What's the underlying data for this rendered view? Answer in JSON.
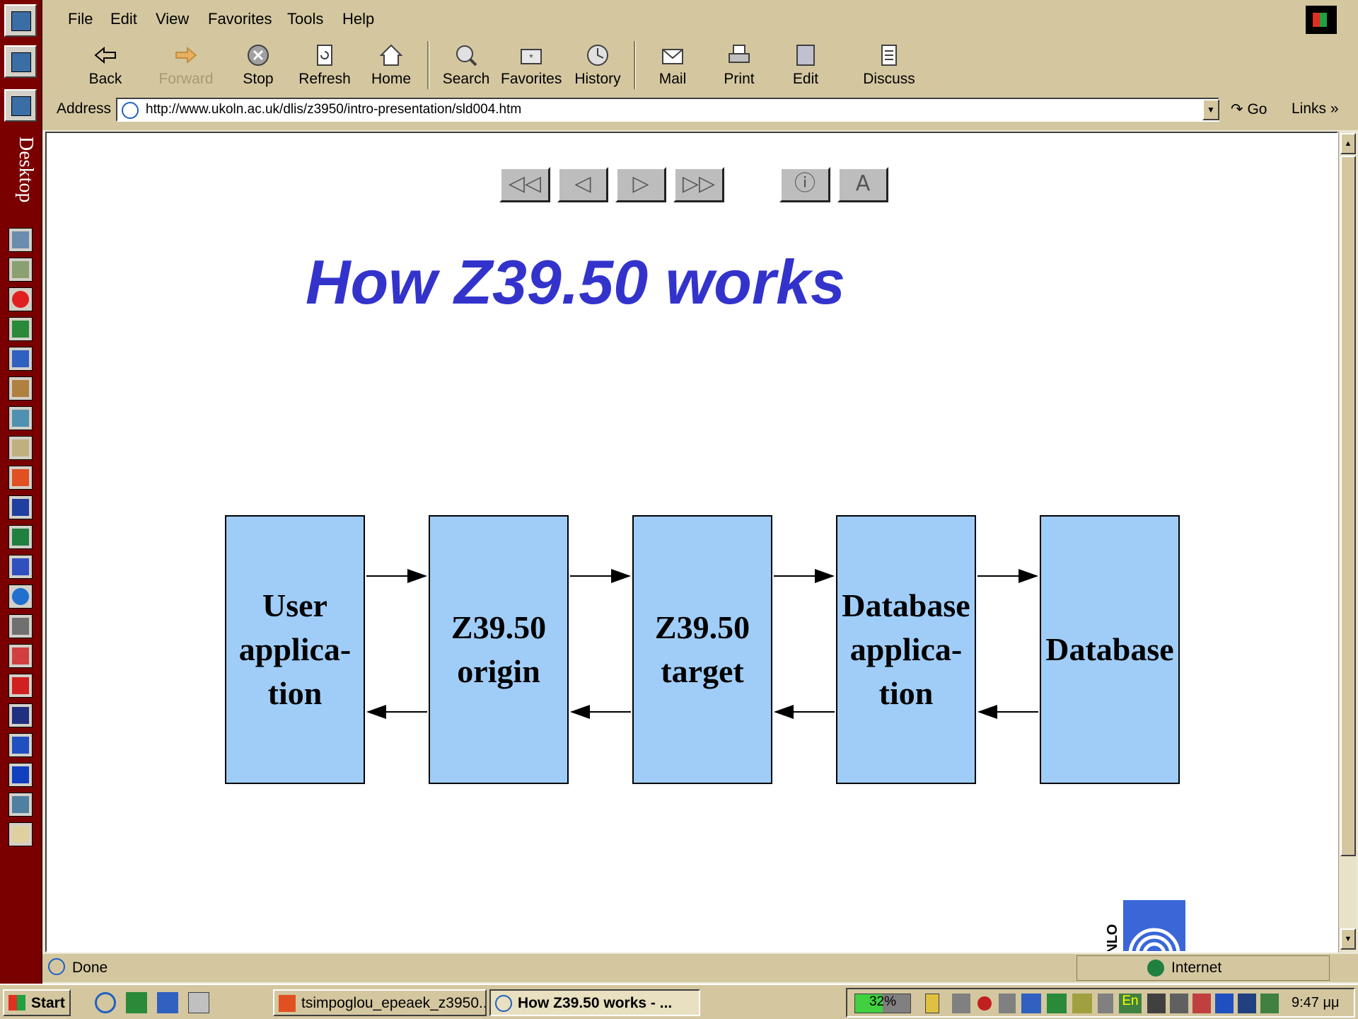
{
  "desktop_bar": {
    "label": "Desktop"
  },
  "menu": [
    "File",
    "Edit",
    "View",
    "Favorites",
    "Tools",
    "Help"
  ],
  "toolbar": {
    "back": "Back",
    "forward": "Forward",
    "stop": "Stop",
    "refresh": "Refresh",
    "home": "Home",
    "search": "Search",
    "favorites": "Favorites",
    "history": "History",
    "mail": "Mail",
    "print": "Print",
    "edit": "Edit",
    "discuss": "Discuss"
  },
  "address": {
    "label": "Address",
    "url": "http://www.ukoln.ac.uk/dlis/z3950/intro-presentation/sld004.htm",
    "go": "Go",
    "links": "Links"
  },
  "slide": {
    "nav": {
      "first": "◁◁",
      "prev": "◁",
      "next": "▷",
      "last": "▷▷",
      "info": "ⓘ",
      "text": "A"
    },
    "title": "How Z39.50 works",
    "boxes": [
      "User applica-tion",
      "Z39.50 origin",
      "Z39.50 target",
      "Database applica-tion",
      "Database"
    ],
    "logo_text": "NLO"
  },
  "status": {
    "text": "Done",
    "zone": "Internet"
  },
  "taskbar": {
    "start": "Start",
    "tasks": [
      "tsimpoglou_epeaek_z3950...",
      "How Z39.50 works - ..."
    ],
    "battery": "32%",
    "lang": "En",
    "clock": "9:47 μμ"
  },
  "colors": {
    "title": "#3333cc",
    "box": "#a0cdf8",
    "chrome": "#d4c7a0",
    "desktop_bar": "#7a0000"
  }
}
